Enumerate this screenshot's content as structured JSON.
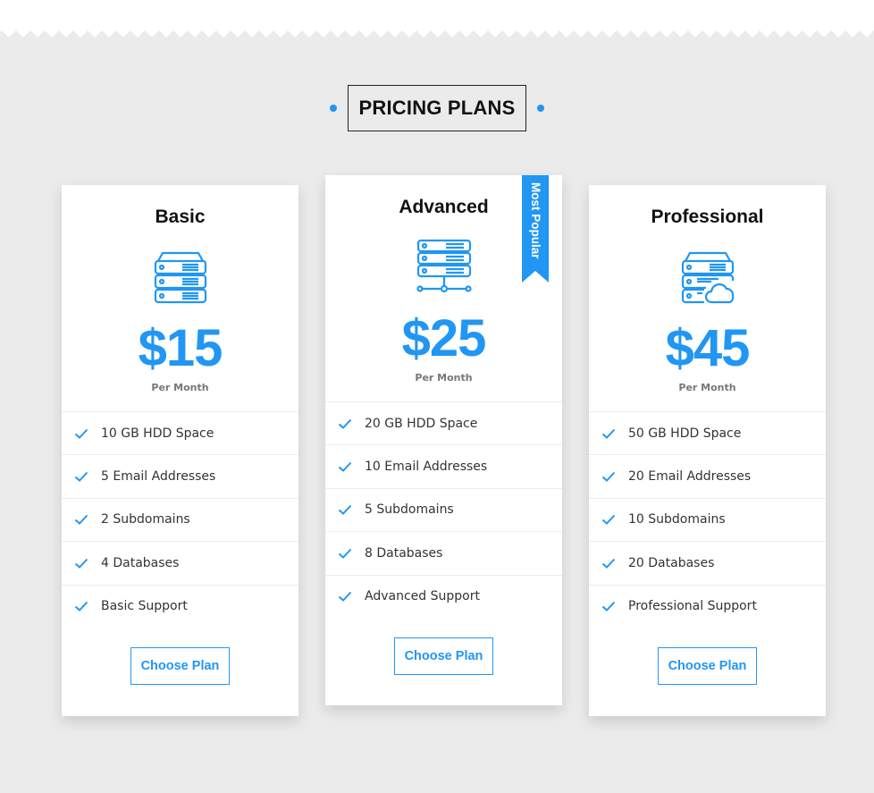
{
  "heading": {
    "title": "PRICING PLANS"
  },
  "colors": {
    "accent": "#2196f3",
    "background": "#ebebeb",
    "card": "#ffffff"
  },
  "plans": [
    {
      "name": "Basic",
      "icon": "server-stack-icon",
      "price": "$15",
      "period": "Per Month",
      "features": [
        "10 GB HDD Space",
        "5 Email Addresses",
        "2 Subdomains",
        "4 Databases",
        "Basic Support"
      ],
      "button_label": "Choose Plan"
    },
    {
      "name": "Advanced",
      "icon": "server-network-icon",
      "price": "$25",
      "period": "Per Month",
      "badge": "Most Popular",
      "features": [
        "20 GB HDD Space",
        "10 Email Addresses",
        "5 Subdomains",
        "8 Databases",
        "Advanced Support"
      ],
      "button_label": "Choose Plan"
    },
    {
      "name": "Professional",
      "icon": "server-cloud-icon",
      "price": "$45",
      "period": "Per Month",
      "features": [
        "50 GB HDD Space",
        "20 Email Addresses",
        "10 Subdomains",
        "20 Databases",
        "Professional Support"
      ],
      "button_label": "Choose Plan"
    }
  ]
}
